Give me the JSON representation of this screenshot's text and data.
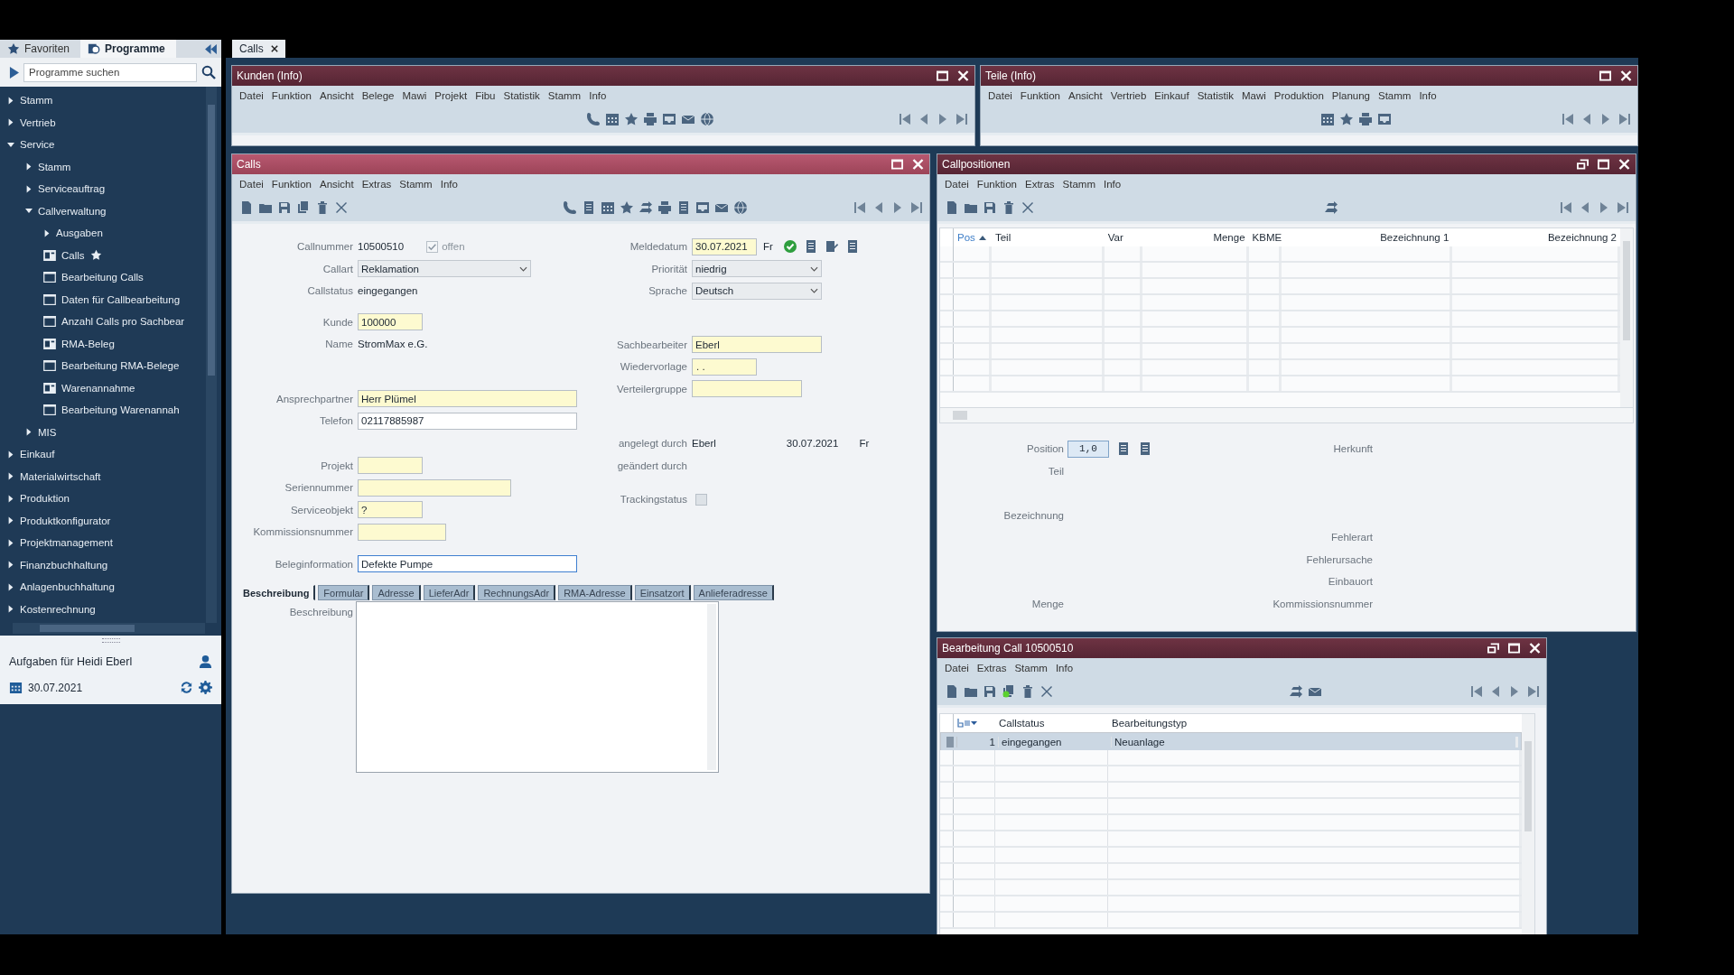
{
  "sidebar": {
    "tabs": [
      {
        "label": "Favoriten",
        "selected": false
      },
      {
        "label": "Programme",
        "selected": true
      }
    ],
    "search": {
      "placeholder": "Programme suchen"
    },
    "tree": [
      {
        "kind": "folder",
        "label": "Stamm",
        "expanded": false
      },
      {
        "kind": "folder",
        "label": "Vertrieb",
        "expanded": false
      },
      {
        "kind": "folder",
        "label": "Service",
        "expanded": true,
        "children": [
          {
            "kind": "folder",
            "label": "Stamm",
            "expanded": false
          },
          {
            "kind": "folder",
            "label": "Serviceauftrag",
            "expanded": false
          },
          {
            "kind": "folder",
            "label": "Callverwaltung",
            "expanded": true,
            "children": [
              {
                "kind": "folder",
                "label": "Ausgaben",
                "expanded": false
              },
              {
                "kind": "report",
                "label": "Calls",
                "favorite": true
              },
              {
                "kind": "form",
                "label": "Bearbeitung Calls",
                "favorite": false
              },
              {
                "kind": "form",
                "label": "Daten für Callbearbeitung",
                "favorite": false
              },
              {
                "kind": "form",
                "label": "Anzahl Calls pro Sachbear",
                "favorite": false
              },
              {
                "kind": "report",
                "label": "RMA-Beleg",
                "favorite": false
              },
              {
                "kind": "form",
                "label": "Bearbeitung RMA-Belege",
                "favorite": false
              },
              {
                "kind": "report",
                "label": "Warenannahme",
                "favorite": false
              },
              {
                "kind": "form",
                "label": "Bearbeitung Warenannah",
                "favorite": false
              }
            ]
          },
          {
            "kind": "folder",
            "label": "MIS",
            "expanded": false
          }
        ]
      },
      {
        "kind": "folder",
        "label": "Einkauf",
        "expanded": false
      },
      {
        "kind": "folder",
        "label": "Materialwirtschaft",
        "expanded": false
      },
      {
        "kind": "folder",
        "label": "Produktion",
        "expanded": false
      },
      {
        "kind": "folder",
        "label": "Produktkonfigurator",
        "expanded": false
      },
      {
        "kind": "folder",
        "label": "Projektmanagement",
        "expanded": false
      },
      {
        "kind": "folder",
        "label": "Finanzbuchhaltung",
        "expanded": false
      },
      {
        "kind": "folder",
        "label": "Anlagenbuchhaltung",
        "expanded": false
      },
      {
        "kind": "folder",
        "label": "Kostenrechnung",
        "expanded": false
      }
    ],
    "tasks": {
      "title": "Aufgaben für Heidi Eberl",
      "date": "30.07.2021"
    }
  },
  "document_tabs": [
    {
      "label": "Calls",
      "selected": true
    }
  ],
  "windows": [
    {
      "kind": "info",
      "title": "Kunden (Info)",
      "active": false,
      "menu": [
        "Datei",
        "Funktion",
        "Ansicht",
        "Belege",
        "Mawi",
        "Projekt",
        "Fibu",
        "Statistik",
        "Stamm",
        "Info"
      ]
    },
    {
      "kind": "info",
      "title": "Teile (Info)",
      "active": false,
      "menu": [
        "Datei",
        "Funktion",
        "Ansicht",
        "Vertrieb",
        "Einkauf",
        "Statistik",
        "Mawi",
        "Produktion",
        "Planung",
        "Stamm",
        "Info"
      ]
    },
    {
      "kind": "calls",
      "title": "Calls",
      "active": true,
      "menu": [
        "Datei",
        "Funktion",
        "Ansicht",
        "Extras",
        "Stamm",
        "Info"
      ],
      "form": {
        "left_groups": [
          [
            {
              "kind": "text",
              "label": "Callnummer",
              "value": "10500510",
              "checkbox": {
                "label": "offen",
                "checked": true
              }
            },
            {
              "kind": "select",
              "label": "Callart",
              "value": "Reklamation"
            },
            {
              "kind": "text",
              "label": "Callstatus",
              "value": "eingegangen"
            }
          ],
          [
            {
              "kind": "input",
              "label": "Kunde",
              "value": "100000",
              "required": true,
              "focused": false
            },
            {
              "kind": "text",
              "label": "Name",
              "value": "StromMax e.G."
            }
          ],
          [
            {
              "kind": "input",
              "label": "Ansprechpartner",
              "value": "Herr Plümel",
              "required": true,
              "focused": false
            },
            {
              "kind": "input",
              "label": "Telefon",
              "value": "02117885987",
              "required": false,
              "focused": false
            }
          ],
          [
            {
              "kind": "input",
              "label": "Projekt",
              "required": true,
              "focused": false
            },
            {
              "kind": "input",
              "label": "Seriennummer",
              "required": true,
              "focused": false
            },
            {
              "kind": "input",
              "label": "Serviceobjekt",
              "value": "?",
              "required": true,
              "focused": false
            },
            {
              "kind": "input",
              "label": "Kommissionsnummer",
              "required": true,
              "focused": false
            }
          ],
          [
            {
              "kind": "input",
              "label": "Beleginformation",
              "value": "Defekte Pumpe",
              "required": false,
              "focused": true
            }
          ]
        ],
        "right_groups": [
          [
            {
              "kind": "date",
              "label": "Meldedatum",
              "value": "30.07.2021",
              "weekday": "Fr",
              "required": true,
              "focused": false
            },
            {
              "kind": "select",
              "label": "Priorität",
              "value": "niedrig"
            },
            {
              "kind": "select",
              "label": "Sprache",
              "value": "Deutsch"
            }
          ],
          [
            {
              "kind": "input",
              "label": "Sachbearbeiter",
              "value": "Eberl",
              "required": true,
              "focused": false
            },
            {
              "kind": "input",
              "label": "Wiedervorlage",
              "placeholder": ". .",
              "required": true,
              "focused": false
            },
            {
              "kind": "input",
              "label": "Verteilergruppe",
              "required": true,
              "focused": false
            }
          ],
          [
            {
              "kind": "text",
              "label": "angelegt durch",
              "value": "Eberl",
              "date": "30.07.2021",
              "weekday": "Fr"
            },
            {
              "kind": "text",
              "label": "geändert durch"
            }
          ],
          [
            {
              "kind": "checkbox",
              "label": "Trackingstatus",
              "checked": false
            }
          ]
        ]
      },
      "tabs": [
        {
          "label": "Beschreibung",
          "selected": true
        },
        {
          "label": "Formular",
          "selected": false
        },
        {
          "label": "Adresse",
          "selected": false
        },
        {
          "label": "LieferAdr",
          "selected": false
        },
        {
          "label": "RechnungsAdr",
          "selected": false
        },
        {
          "label": "RMA-Adresse",
          "selected": false
        },
        {
          "label": "Einsatzort",
          "selected": false
        },
        {
          "label": "Anlieferadresse",
          "selected": false
        }
      ],
      "description_label": "Beschreibung"
    },
    {
      "kind": "positions",
      "title": "Callpositionen",
      "active": false,
      "menu": [
        "Datei",
        "Funktion",
        "Extras",
        "Stamm",
        "Info"
      ],
      "columns": [
        {
          "label": "Pos",
          "sorted": true
        },
        {
          "label": "Teil",
          "sorted": false
        },
        {
          "label": "Var",
          "sorted": false
        },
        {
          "label": "Menge",
          "sorted": false
        },
        {
          "label": "KBME",
          "sorted": false
        },
        {
          "label": "Bezeichnung 1",
          "sorted": false
        },
        {
          "label": "Bezeichnung 2",
          "sorted": false
        }
      ],
      "detail": {
        "left": [
          {
            "label": "Position",
            "value": "1,0"
          },
          {
            "label": "Teil"
          },
          {
            "label": "Bezeichnung"
          },
          {
            "label": "Menge"
          }
        ],
        "right": [
          {
            "label": "Herkunft"
          },
          {
            "label": "Fehlerart"
          },
          {
            "label": "Fehlerursache"
          },
          {
            "label": "Einbauort"
          },
          {
            "label": "Kommissionsnummer"
          }
        ]
      }
    },
    {
      "kind": "history",
      "title": "Bearbeitung Call 10500510",
      "active": false,
      "menu": [
        "Datei",
        "Extras",
        "Stamm",
        "Info"
      ],
      "columns": [
        {
          "label": "Callstatus"
        },
        {
          "label": "Bearbeitungstyp"
        }
      ],
      "rows": [
        {
          "number": "1",
          "cells": [
            "eingegangen",
            "Neuanlage"
          ],
          "selected": true
        }
      ]
    }
  ]
}
